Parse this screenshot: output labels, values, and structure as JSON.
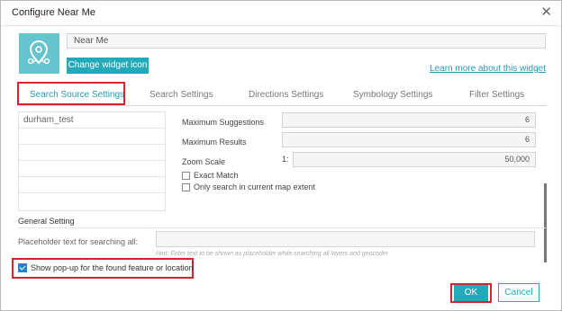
{
  "dialog": {
    "title": "Configure Near Me",
    "close_icon": "close-icon"
  },
  "widget": {
    "icon": "map-pin-icon",
    "name_value": "Near Me",
    "change_icon_label": "Change widget icon",
    "learn_more_label": "Learn more about this widget"
  },
  "tabs": [
    {
      "label": "Search Source Settings",
      "active": true
    },
    {
      "label": "Search Settings",
      "active": false
    },
    {
      "label": "Directions Settings",
      "active": false
    },
    {
      "label": "Symbology Settings",
      "active": false
    },
    {
      "label": "Filter Settings",
      "active": false
    }
  ],
  "sources": [
    "durham_test"
  ],
  "settings": {
    "max_suggestions_label": "Maximum Suggestions",
    "max_suggestions_value": "6",
    "max_results_label": "Maximum Results",
    "max_results_value": "6",
    "zoom_scale_label": "Zoom Scale",
    "zoom_scale_prefix": "1:",
    "zoom_scale_value": "50,000",
    "exact_match_label": "Exact Match",
    "exact_match_checked": false,
    "map_extent_label": "Only search in current map extent",
    "map_extent_checked": false
  },
  "general": {
    "heading": "General Setting",
    "placeholder_label": "Placeholder text for searching all:",
    "placeholder_value": "",
    "hint": "Hint: Enter text to be shown as placeholder while searching all layers and geocoder",
    "popup_label": "Show pop-up for the found feature or location",
    "popup_checked": true
  },
  "footer": {
    "ok_label": "OK",
    "cancel_label": "Cancel"
  },
  "colors": {
    "accent": "#24a9b9",
    "highlight_box": "#d6232f",
    "checkbox_checked": "#2486c6"
  }
}
